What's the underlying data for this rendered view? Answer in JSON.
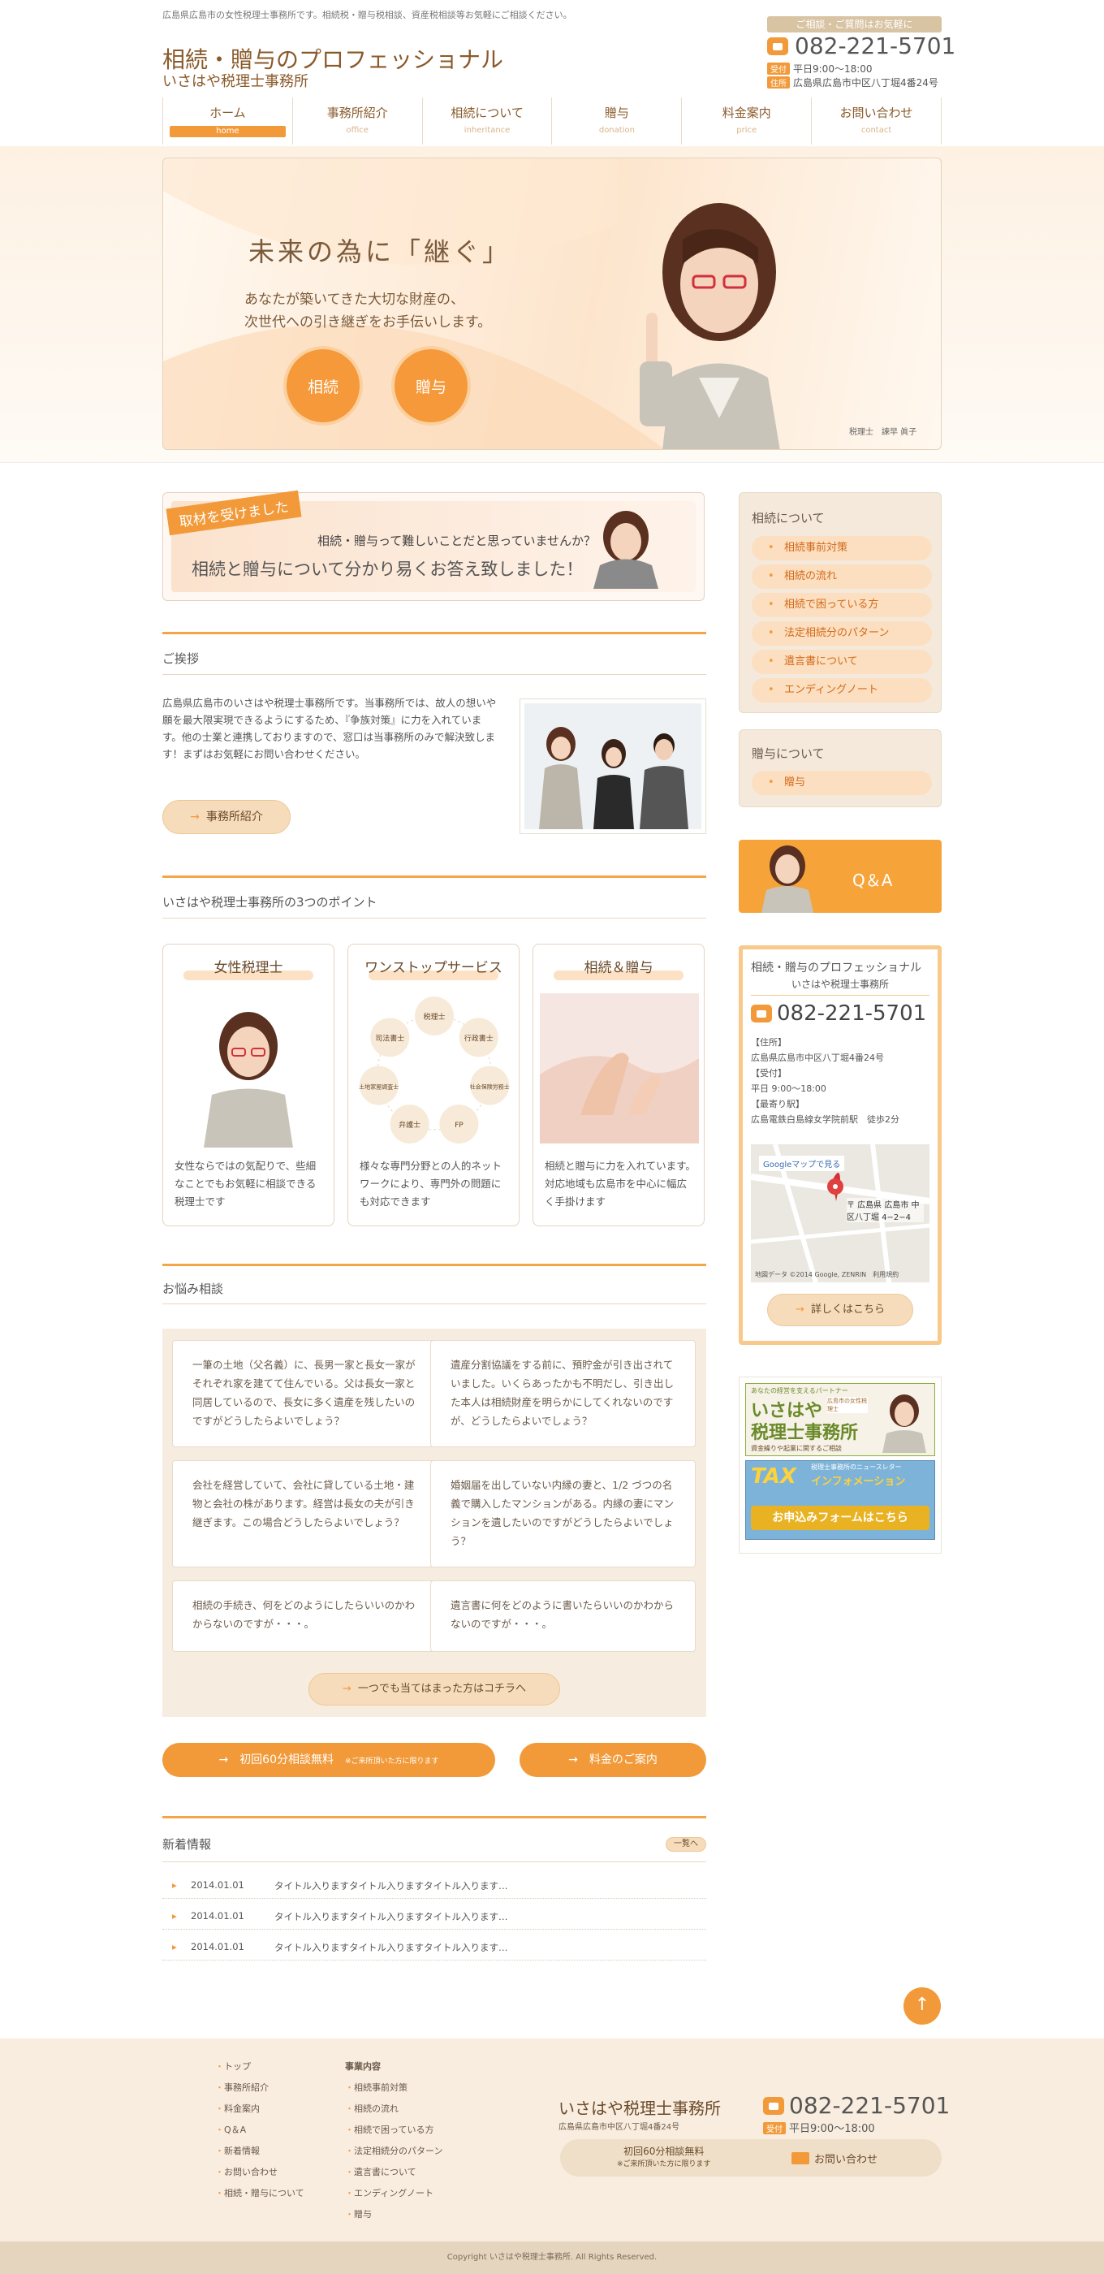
{
  "header": {
    "tagline": "広島県広島市の女性税理士事務所です。相続税・贈与税相談、資産税相談等お気軽にご相談ください。",
    "title": "相続・贈与のプロフェッショナル",
    "office": "いさはや税理士事務所",
    "contact_tag": "ご相談・ご質問はお気軽に",
    "phone": "082-221-5701",
    "hours_tag": "受付",
    "hours": "平日9:00～18:00",
    "addr_tag": "住所",
    "addr": "広島県広島市中区八丁堀4番24号"
  },
  "nav": [
    {
      "ja": "ホーム",
      "en": "home"
    },
    {
      "ja": "事務所紹介",
      "en": "office"
    },
    {
      "ja": "相続について",
      "en": "inheritance"
    },
    {
      "ja": "贈与",
      "en": "donation"
    },
    {
      "ja": "料金案内",
      "en": "price"
    },
    {
      "ja": "お問い合わせ",
      "en": "contact"
    }
  ],
  "hero": {
    "title": "未来の為に「継ぐ」",
    "line1": "あなたが築いてきた大切な財産の、",
    "line2": "次世代への引き継ぎをお手伝いします。",
    "btn1": "相続",
    "btn2": "贈与",
    "caption": "税理士　諫早 眞子"
  },
  "featured": {
    "tag": "取材を受けました",
    "line1": "相続・贈与って難しいことだと思っていませんか？",
    "line2": "相続と贈与について分かり易くお答え致しました！"
  },
  "greeting": {
    "heading": "ご挨拶",
    "text": "広島県広島市のいさはや税理士事務所です。当事務所では、故人の想いや願を最大限実現できるようにするため、『争族対策』に力を入れています。他の士業と連携しておりますので、窓口は当事務所のみで解決致します！まずはお気軽にお問い合わせください。",
    "button": "事務所紹介"
  },
  "points": {
    "heading": "いさはや税理士事務所の3つのポイント",
    "cards": [
      {
        "title": "女性税理士",
        "text": "女性ならではの気配りで、些細なことでもお気軽に相談できる税理士です"
      },
      {
        "title": "ワンストップサービス",
        "text": "様々な専門分野との人的ネットワークにより、専門外の問題にも対応できます"
      },
      {
        "title": "相続＆贈与",
        "text": "相続と贈与に力を入れています。対応地域も広島市を中心に幅広く手掛けます"
      }
    ],
    "network": [
      "税理士",
      "行政書士",
      "社会保険労務士",
      "FP",
      "弁護士",
      "土地家屋調査士",
      "司法書士"
    ]
  },
  "worries": {
    "heading": "お悩み相談",
    "items": [
      "一筆の土地（父名義）に、長男一家と長女一家がそれぞれ家を建てて住んでいる。父は長女一家と同居しているので、長女に多く遺産を残したいのですがどうしたらよいでしょう？",
      "遺産分割協議をする前に、預貯金が引き出されていました。いくらあったかも不明だし、引き出した本人は相続財産を明らかにしてくれないのですが、どうしたらよいでしょう？",
      "会社を経営していて、会社に貸している土地・建物と会社の株があります。経営は長女の夫が引き継ぎます。この場合どうしたらよいでしょう？",
      "婚姻届を出していない内縁の妻と、1/2 づつの名義で購入したマンションがある。内縁の妻にマンションを遺したいのですがどうしたらよいでしょう？",
      "相続の手続き、何をどのようにしたらいいのかわからないのですが・・・。",
      "遺言書に何をどのように書いたらいいのかわからないのですが・・・。"
    ],
    "more": "一つでも当てはまった方はコチラへ"
  },
  "cta": {
    "consult": "初回60分相談無料",
    "consult_note": "※ご来所頂いた方に限ります",
    "price": "料金のご案内"
  },
  "news": {
    "heading": "新着情報",
    "all": "一覧へ",
    "items": [
      {
        "date": "2014.01.01",
        "title": "タイトル入りますタイトル入りますタイトル入ります…"
      },
      {
        "date": "2014.01.01",
        "title": "タイトル入りますタイトル入りますタイトル入ります…"
      },
      {
        "date": "2014.01.01",
        "title": "タイトル入りますタイトル入りますタイトル入ります…"
      }
    ]
  },
  "sidebar": {
    "inherit_title": "相続について",
    "inherit_items": [
      "相続事前対策",
      "相続の流れ",
      "相続で困っている方",
      "法定相続分のパターン",
      "遺言書について",
      "エンディングノート"
    ],
    "gift_title": "贈与について",
    "gift_items": [
      "贈与"
    ],
    "qa": "Q＆A",
    "contact": {
      "title": "相続・贈与のプロフェッショナル",
      "office": "いさはや税理士事務所",
      "phone": "082-221-5701",
      "addr_label": "【住所】",
      "addr": "広島県広島市中区八丁堀4番24号",
      "hours_label": "【受付】",
      "hours": "平日 9:00～18:00",
      "station_label": "【最寄り駅】",
      "station": "広島電鉄白島線女学院前駅　徒歩2分",
      "map_link": "Googleマップで見る",
      "map_label": "〒 広島県 広島市 中区八丁堀 4−2−4",
      "map_credit": "地図データ ©2014 Google, ZENRIN　利用規約",
      "details": "詳しくはこちら"
    },
    "banner": {
      "small": "あなたの経営を支えるパートナー",
      "name1": "いさはや",
      "name2": "税理士事務所",
      "badge": "広島市の女性税理士",
      "sub": "資金繰りや起業に関するご相談",
      "tax": "TAX",
      "info": "インフォメーション",
      "news": "税理士事務所のニュースレター",
      "form": "お申込みフォームはこちら"
    }
  },
  "footer": {
    "links1": [
      "トップ",
      "事務所紹介",
      "料金案内",
      "Q＆A",
      "新着情報",
      "お問い合わせ",
      "相続・贈与について"
    ],
    "links2_title": "事業内容",
    "links2": [
      "相続事前対策",
      "相続の流れ",
      "相続で困っている方",
      "法定相続分のパターン",
      "遺言書について",
      "エンディングノート",
      "贈与"
    ],
    "office": "いさはや税理士事務所",
    "addr": "広島県広島市中区八丁堀4番24号",
    "phone": "082-221-5701",
    "hours_tag": "受付",
    "hours": "平日9:00～18:00",
    "consult": "初回60分相談無料",
    "consult_note": "※ご来所頂いた方に限ります",
    "contact": "お問い合わせ",
    "copyright": "Copyright いさはや税理士事務所. All Rights Reserved."
  },
  "colors": {
    "accent": "#f29a3a",
    "brown": "#8a5a2a",
    "beige": "#f7ece0"
  }
}
